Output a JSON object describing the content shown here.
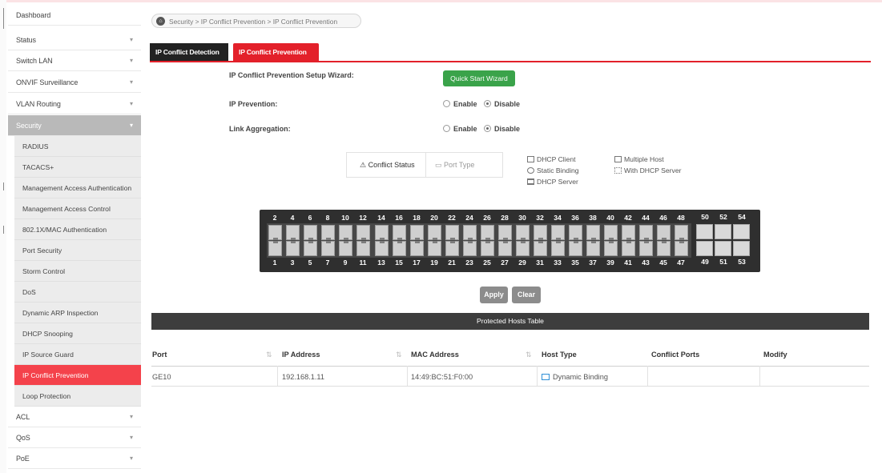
{
  "sidebar": {
    "items": [
      {
        "label": "Dashboard",
        "chevron": ""
      },
      {
        "label": "Status",
        "chevron": "⌄"
      },
      {
        "label": "Switch LAN",
        "chevron": "⌄"
      },
      {
        "label": "ONVIF Surveillance",
        "chevron": "⌄"
      },
      {
        "label": "VLAN Routing",
        "chevron": "⌄"
      },
      {
        "label": "Security",
        "chevron": "⌄"
      }
    ],
    "security_sub": [
      "RADIUS",
      "TACACS+",
      "Management Access Authentication",
      "Management Access Control",
      "802.1X/MAC Authentication",
      "Port Security",
      "Storm Control",
      "DoS",
      "Dynamic ARP Inspection",
      "DHCP Snooping",
      "IP Source Guard",
      "IP Conflict Prevention",
      "Loop Protection"
    ],
    "bottom_items": [
      {
        "label": "ACL",
        "chevron": "⌄"
      },
      {
        "label": "QoS",
        "chevron": "⌄"
      },
      {
        "label": "PoE",
        "chevron": "⌄"
      }
    ]
  },
  "breadcrumb": "Security > IP Conflict Prevention > IP Conflict Prevention",
  "tabs": [
    "IP Conflict Detection",
    "IP Conflict Prevention"
  ],
  "form": {
    "wizard_label": "IP Conflict Prevention Setup Wizard:",
    "wizard_button": "Quick Start Wizard",
    "ip_prevention_label": "IP Prevention:",
    "link_aggregation_label": "Link Aggregation:",
    "enable": "Enable",
    "disable": "Disable",
    "ip_prevention_value": "Disable",
    "link_aggregation_value": "Disable"
  },
  "status_tabs": {
    "conflict": "Conflict Status",
    "port_type": "Port Type"
  },
  "legend": {
    "dhcp_client": "DHCP Client",
    "static_binding": "Static Binding",
    "dhcp_server": "DHCP Server",
    "multiple_host": "Multiple Host",
    "with_dhcp_server": "With DHCP Server"
  },
  "switch": {
    "top_numbers": [
      "2",
      "4",
      "6",
      "8",
      "10",
      "12",
      "14",
      "16",
      "18",
      "20",
      "22",
      "24",
      "26",
      "28",
      "30",
      "32",
      "34",
      "36",
      "38",
      "40",
      "42",
      "44",
      "46",
      "48",
      "50",
      "52",
      "54"
    ],
    "bottom_numbers": [
      "1",
      "3",
      "5",
      "7",
      "9",
      "11",
      "13",
      "15",
      "17",
      "19",
      "21",
      "23",
      "25",
      "27",
      "29",
      "31",
      "33",
      "35",
      "37",
      "39",
      "41",
      "43",
      "45",
      "47",
      "49",
      "51",
      "53"
    ]
  },
  "buttons": {
    "apply": "Apply",
    "clear": "Clear"
  },
  "table": {
    "title": "Protected Hosts Table",
    "headers": [
      "Port",
      "IP Address",
      "MAC Address",
      "Host Type",
      "Conflict Ports",
      "Modify"
    ],
    "rows": [
      {
        "port": "GE10",
        "ip": "192.168.1.11",
        "mac": "14:49:BC:51:F0:00",
        "host_type": "Dynamic Binding",
        "conflict_ports": "",
        "modify": ""
      }
    ]
  },
  "colors": {
    "accent": "#e3202a",
    "green": "#3aa34a",
    "active_menu": "#f4424b"
  }
}
